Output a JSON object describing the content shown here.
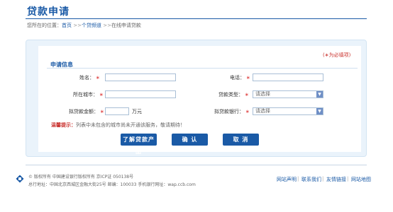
{
  "header": {
    "title": "贷款申请"
  },
  "breadcrumb": {
    "prefix": "您所在的位置：",
    "home": "首页",
    "sep1": ">>",
    "personal": "个贷频道",
    "sep2": ">>",
    "current": "在线申请贷款"
  },
  "form": {
    "required_note": "(∗为必填项)",
    "section_title": "申请信息",
    "name_label": "姓名：",
    "phone_label": "电话：",
    "city_label": "所在城市：",
    "loan_type_label": "贷款类型：",
    "loan_type_value": "请选择",
    "amount_label": "拟贷款金额：",
    "amount_unit": "万元",
    "bank_label": "拟贷款银行：",
    "bank_value": "请选择",
    "required_mark": "∗",
    "tip_label": "温馨提示：",
    "tip_text": "列表中未包含的城市尚未开通该服务，敬请期待！"
  },
  "buttons": {
    "learn": "了解贷款产品",
    "confirm": "确 认",
    "cancel": "取 消"
  },
  "footer": {
    "copyright": "© 版权所有  中国建设银行版权所有  京ICP证 050138号",
    "address": "总行地址：中国北京西城区金融大街25号     邮编：100033     手机银行网址：wap.ccb.com",
    "links": [
      "网站声明",
      "联系我们",
      "友情链接",
      "网站地图"
    ],
    "separator": "|"
  },
  "colors": {
    "accent": "#1a5aa6",
    "required": "#d33333",
    "panel": "#eaf3fb"
  }
}
